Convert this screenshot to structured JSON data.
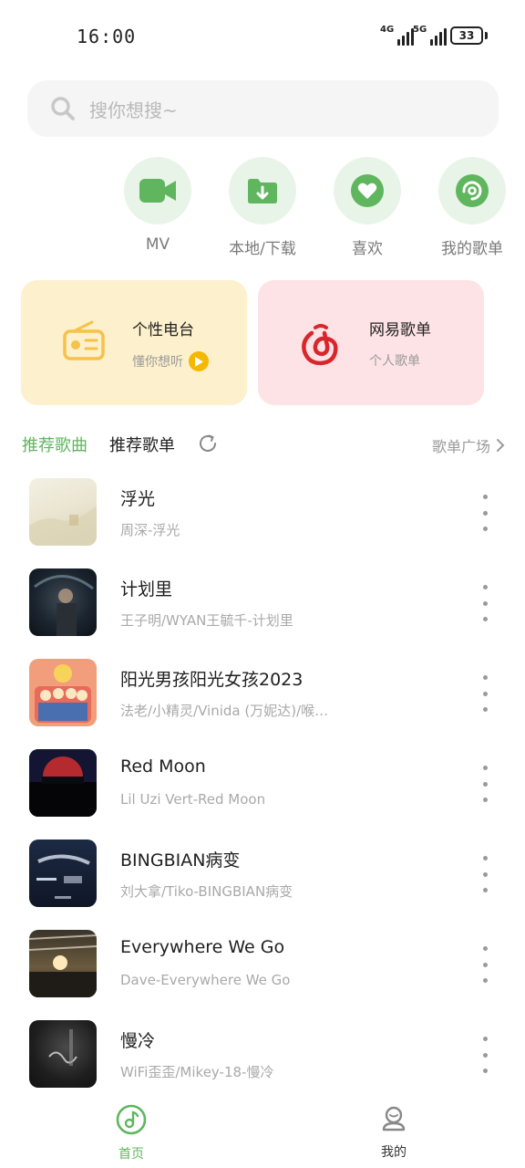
{
  "status_bar": {
    "time": "16:00",
    "signal1": "4G",
    "signal2": "5G",
    "battery": "33"
  },
  "search": {
    "placeholder": "搜你想搜~"
  },
  "quick_actions": [
    {
      "label": "MV",
      "icon": "video-camera-icon"
    },
    {
      "label": "本地/下载",
      "icon": "download-folder-icon"
    },
    {
      "label": "喜欢",
      "icon": "heart-icon"
    },
    {
      "label": "我的歌单",
      "icon": "disc-icon"
    }
  ],
  "cards": {
    "radio": {
      "title": "个性电台",
      "subtitle": "懂你想听",
      "icon": "radio-icon"
    },
    "netease": {
      "title": "网易歌单",
      "subtitle": "个人歌单",
      "icon": "netease-music-icon"
    }
  },
  "tabs": {
    "songs": "推荐歌曲",
    "playlists": "推荐歌单",
    "plaza": "歌单广场"
  },
  "songs": [
    {
      "name": "浮光",
      "artist": "周深-浮光"
    },
    {
      "name": "计划里",
      "artist": "王子明/WYAN王毓千-计划里"
    },
    {
      "name": "阳光男孩阳光女孩2023",
      "artist": "法老/小精灵/Vinida (万妮达)/喉…"
    },
    {
      "name": "Red Moon",
      "artist": "Lil Uzi Vert-Red Moon"
    },
    {
      "name": "BINGBIAN病变",
      "artist": "刘大拿/Tiko-BINGBIAN病变"
    },
    {
      "name": "Everywhere We Go",
      "artist": "Dave-Everywhere We Go"
    },
    {
      "name": "慢冷",
      "artist": "WiFi歪歪/Mikey-18-慢冷"
    }
  ],
  "bottom_nav": {
    "home": "首页",
    "mine": "我的"
  },
  "colors": {
    "accent": "#5fb65f",
    "radio_card": "#fdf0cc",
    "netease_card": "#fde3e5",
    "netease_red": "#d8262c"
  }
}
